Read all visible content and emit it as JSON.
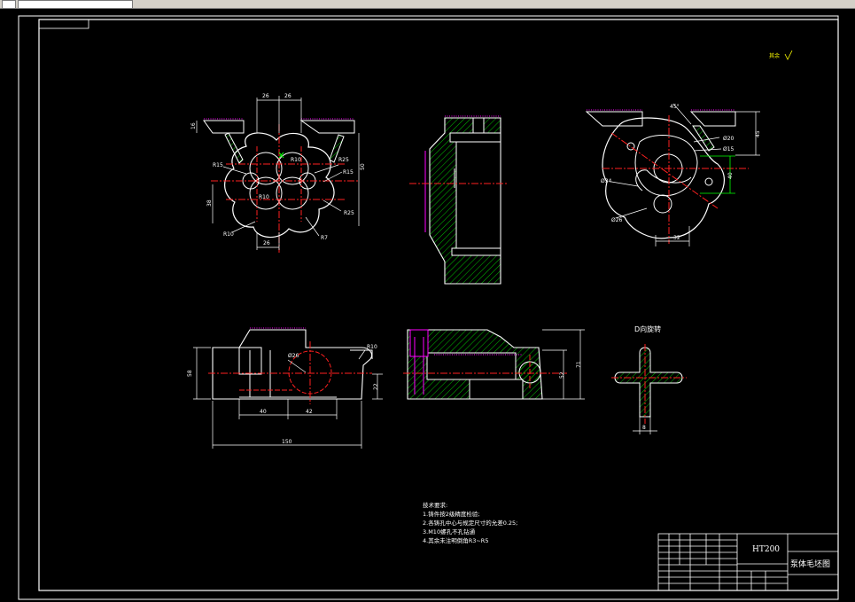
{
  "material": "HT200",
  "drawing_title": "泵体毛坯图",
  "view_label": "D向旋转",
  "roughness_note": "其余",
  "requirements": [
    "技术要求:",
    "1.铸件按2级精度检验;",
    "2.各铸孔中心与规定尺寸的允差0.25;",
    "3.M10螺孔不孔钻通",
    "4.其余未注明倒角R3~R5"
  ],
  "dims": {
    "top_26a": "26",
    "top_26b": "26",
    "left_h": "16",
    "r15": "R15",
    "r10": "R10",
    "r25a": "R25",
    "r15b": "R15",
    "dia50": "50",
    "h38": "38",
    "r10b": "R10",
    "r25b": "R25",
    "r10c": "R10",
    "r7": "R7",
    "bottom_26": "26",
    "ang45": "45°",
    "d20": "Ø20",
    "d15": "Ø15",
    "v45": "45",
    "v40": "40",
    "d34": "Ø34",
    "d26": "Ø26",
    "b32": "32",
    "r10d": "R10",
    "d26b": "Ø26",
    "h58": "58",
    "h22": "22",
    "w40": "40",
    "w42": "42",
    "w150": "150",
    "h71": "71",
    "h52": "52",
    "t8": "8"
  },
  "colors": {
    "outline": "#ffffff",
    "center": "#ff2020",
    "hatch": "#00c000",
    "hidden": "#ff00ff",
    "yellow": "#ffff00",
    "dimgreen": "#00ff00"
  }
}
